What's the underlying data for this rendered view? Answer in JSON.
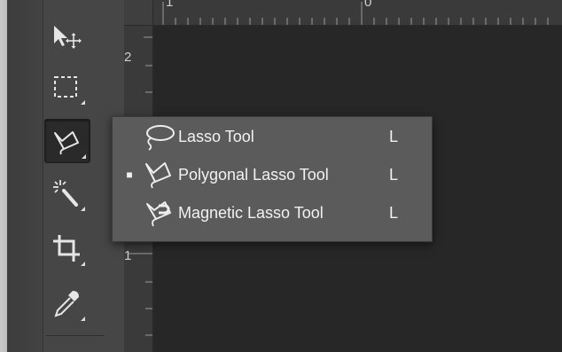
{
  "rulers": {
    "top_labels": [
      "1",
      "0"
    ],
    "left_labels": [
      "2",
      "1"
    ]
  },
  "toolbar": {
    "tools": [
      {
        "name": "move-tool",
        "icon": "move-icon"
      },
      {
        "name": "marquee-tool",
        "icon": "rectangular-marquee-icon"
      },
      {
        "name": "lasso-tool",
        "icon": "polygonal-lasso-icon",
        "active": true
      },
      {
        "name": "magic-wand-tool",
        "icon": "magic-wand-icon"
      },
      {
        "name": "crop-tool",
        "icon": "crop-icon"
      },
      {
        "name": "eyedropper-tool",
        "icon": "eyedropper-icon"
      }
    ]
  },
  "flyout": {
    "items": [
      {
        "label": "Lasso Tool",
        "shortcut": "L",
        "selected": false,
        "icon": "lasso-icon"
      },
      {
        "label": "Polygonal Lasso Tool",
        "shortcut": "L",
        "selected": true,
        "icon": "polygonal-lasso-icon"
      },
      {
        "label": "Magnetic Lasso Tool",
        "shortcut": "L",
        "selected": false,
        "icon": "magnetic-lasso-icon"
      }
    ],
    "selected_mark": "■"
  },
  "colors": {
    "toolbar_bg": "#464646",
    "canvas_bg": "#272727",
    "menu_bg": "#5b5b5b",
    "text": "#f2f2f2"
  }
}
